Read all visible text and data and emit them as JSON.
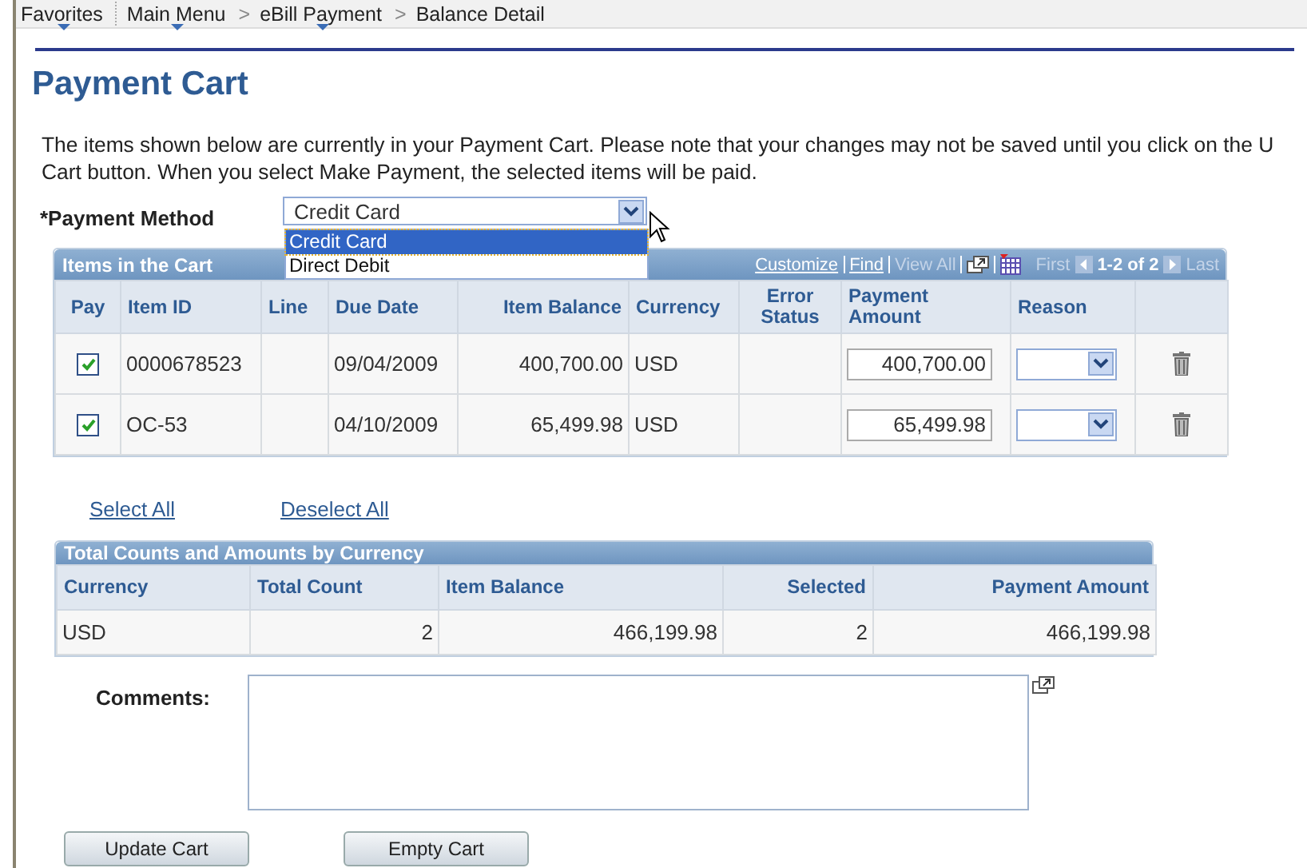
{
  "breadcrumb": [
    {
      "label": "Favorites",
      "menu": true
    },
    {
      "label": "Main Menu",
      "menu": true
    },
    {
      "label": "eBill Payment",
      "separator": ">",
      "menu": true
    },
    {
      "label": "Balance Detail",
      "separator": ">",
      "menu": false
    }
  ],
  "title": "Payment Cart",
  "intro": [
    "The items shown below are currently in your Payment Cart. Please note that your changes may not be saved until you click on the U",
    "Cart button. When you select Make Payment, the selected items will be paid."
  ],
  "payment_method": {
    "label": "*Payment Method",
    "value": "Credit Card",
    "expanded": true,
    "options": [
      {
        "label": "Credit Card",
        "selected": true
      },
      {
        "label": "Direct Debit",
        "selected": false
      }
    ]
  },
  "items_grid": {
    "title": "Items in the Cart",
    "toolbar": [
      {
        "label": "Customize",
        "disabled": false
      },
      {
        "label": "Find",
        "disabled": false
      },
      {
        "label": "View All",
        "disabled": true
      }
    ],
    "first": {
      "label": "First",
      "disabled": true
    },
    "range": "1-2 of 2",
    "last": {
      "label": "Last",
      "disabled": true
    },
    "columns": [
      "Pay",
      "Item ID",
      "Line",
      "Due Date",
      "Item Balance",
      "Currency",
      "Error Status",
      "Payment Amount",
      "Reason"
    ],
    "rows": [
      {
        "checked": true,
        "item_id": "0000678523",
        "due_date": "09/04/2009",
        "item_balance": "400,700.00",
        "currency": "USD",
        "payment_amount": "400,700.00"
      },
      {
        "checked": true,
        "item_id": "OC-53",
        "due_date": "04/10/2009",
        "item_balance": "65,499.98",
        "currency": "USD",
        "payment_amount": "65,499.98"
      }
    ]
  },
  "links": [
    "Select All",
    "Deselect All"
  ],
  "totals_grid": {
    "title": "Total Counts and Amounts by Currency",
    "columns": [
      "Currency",
      "Total Count",
      "Item Balance",
      "Selected",
      "Payment Amount"
    ],
    "rows": [
      [
        "USD",
        "2",
        "466,199.98",
        "2",
        "466,199.98"
      ]
    ]
  },
  "comments": {
    "label": "Comments:"
  },
  "buttons": [
    "Update Cart",
    "Empty Cart"
  ]
}
